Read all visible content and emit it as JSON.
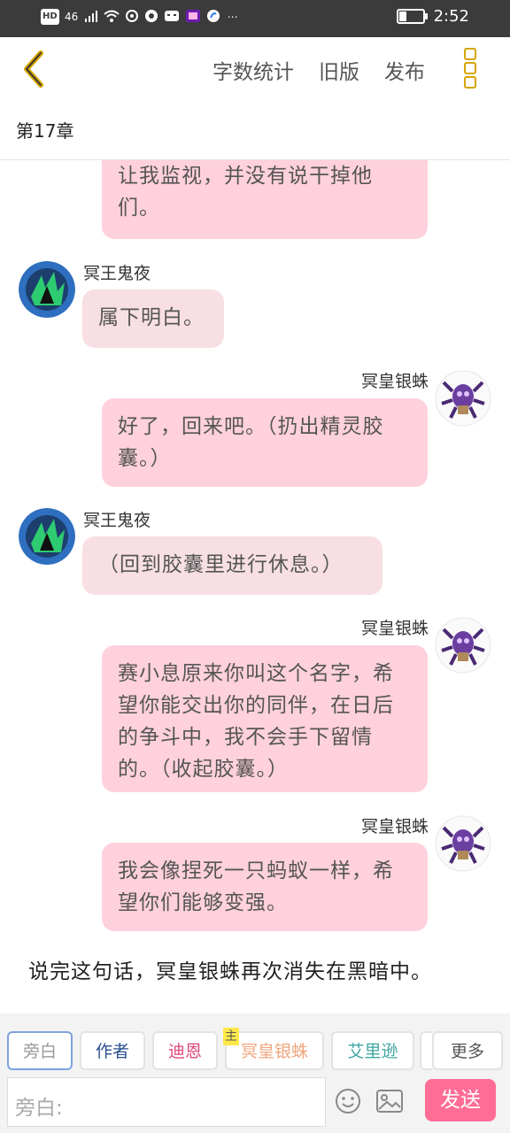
{
  "status_bar": {
    "icons_left": [
      "HD",
      "4G",
      "signal-icon",
      "wifi-icon",
      "app-icon",
      "app-icon",
      "app-icon",
      "app-icon",
      "app-icon",
      "⋯"
    ],
    "hd": "HD",
    "net": "46",
    "dots": "⋯",
    "time": "2:52",
    "battery_level": 0.3
  },
  "top_bar": {
    "actions": [
      "字数统计",
      "旧版",
      "发布"
    ],
    "accent_color": "#d6a500"
  },
  "chapter": {
    "title": "第17章"
  },
  "messages": [
    {
      "side": "right",
      "text_lines": [
        "让我监视，并没有说干掉他",
        "们。"
      ]
    },
    {
      "side": "left",
      "sender": "冥王鬼夜",
      "text_lines": [
        "属下明白。"
      ]
    },
    {
      "side": "right",
      "sender": "冥皇银蛛",
      "text_lines": [
        "好了，回来吧。（扔出精灵胶",
        "囊。）"
      ]
    },
    {
      "side": "left",
      "sender": "冥王鬼夜",
      "text_lines": [
        "（回到胶囊里进行休息。）"
      ]
    },
    {
      "side": "right",
      "sender": "冥皇银蛛",
      "text_lines": [
        "赛小息原来你叫这个名字，希",
        "望你能交出你的同伴，在日后",
        "的争斗中，我不会手下留情",
        "的。（收起胶囊。）"
      ]
    },
    {
      "side": "right",
      "sender": "冥皇银蛛",
      "text_lines": [
        "我会像捏死一只蚂蚁一样，希",
        "望你们能够变强。"
      ]
    }
  ],
  "narration": "说完这句话，冥皇银蛛再次消失在黑暗中。",
  "composer": {
    "characters": [
      {
        "label": "旁白",
        "color": "#999999",
        "selected": true
      },
      {
        "label": "作者",
        "color": "#2a4f8f"
      },
      {
        "label": "迪恩",
        "color": "#e0457a"
      },
      {
        "label": "冥皇银蛛",
        "color": "#f0a57c",
        "badge": "主"
      },
      {
        "label": "艾里逊",
        "color": "#3fa7a2"
      }
    ],
    "more_label": "更多",
    "input_placeholder": "旁白:",
    "send_label": "发送",
    "send_color": "#ff6d97"
  }
}
